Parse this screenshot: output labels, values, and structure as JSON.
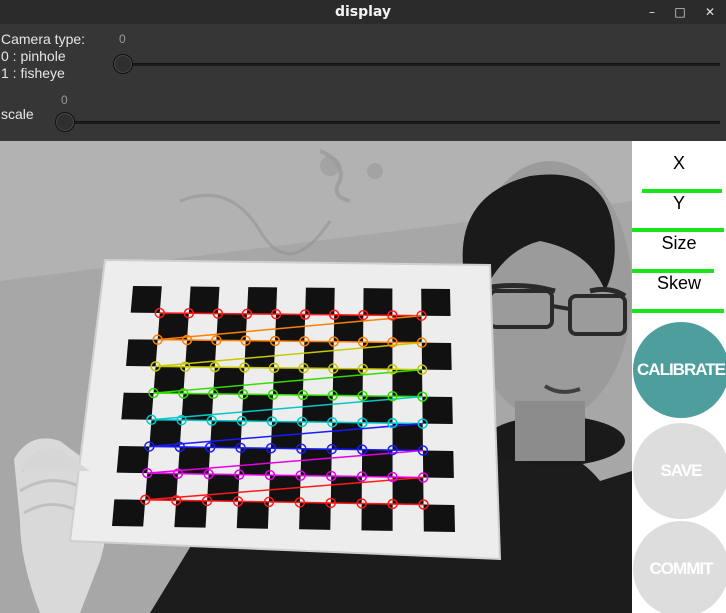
{
  "window": {
    "title": "display",
    "controls": {
      "minimize": "–",
      "maximize": "□",
      "close": "✕"
    }
  },
  "trackbars": [
    {
      "label": "Camera type:\n0 : pinhole\n1 : fisheye",
      "value": "0"
    },
    {
      "label": "scale",
      "value": "0"
    }
  ],
  "panel": {
    "metrics": [
      {
        "label": "X",
        "level": 0.85
      },
      {
        "label": "Y",
        "level": 0.98
      },
      {
        "label": "Size",
        "level": 0.87
      },
      {
        "label": "Skew",
        "level": 0.98
      }
    ],
    "buttons": [
      {
        "label": "CALIBRATE",
        "color": "#4f9e9e",
        "enabled": true
      },
      {
        "label": "SAVE",
        "color": "#dddddd",
        "enabled": false
      },
      {
        "label": "COMMIT",
        "color": "#dddddd",
        "enabled": false
      }
    ],
    "bar_color": "#19e619"
  },
  "camera_feed": {
    "icon": "webcam-feed",
    "row_colors": [
      "#ff1a1a",
      "#ff8000",
      "#c8c800",
      "#33dd00",
      "#00c8c8",
      "#1a1aff",
      "#e600e6",
      "#ff1a1a"
    ]
  }
}
